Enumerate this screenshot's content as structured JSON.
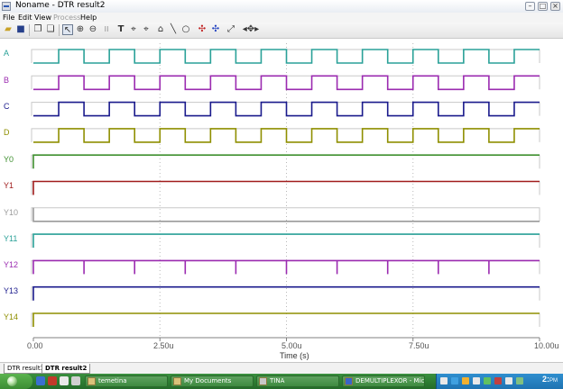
{
  "window": {
    "title": "Noname - DTR result2"
  },
  "menu": [
    {
      "label": "File",
      "enabled": true
    },
    {
      "label": "Edit",
      "enabled": true
    },
    {
      "label": "View",
      "enabled": true
    },
    {
      "label": "Process",
      "enabled": false
    },
    {
      "label": "Help",
      "enabled": true
    }
  ],
  "toolbar": {
    "icons": [
      "open-icon",
      "save-icon",
      "copy-icon",
      "paste-icon",
      "pointer-icon",
      "zoom-in-icon",
      "zoom-out-icon",
      "grid-icon",
      "text-icon",
      "cursor-a-icon",
      "cursor-b-icon",
      "line-icon",
      "wire-icon",
      "circle-icon",
      "marker-red-icon",
      "marker-blue-icon",
      "edit-graph-icon",
      "pan-icon"
    ],
    "pressed": "pointer-icon"
  },
  "chart_data": {
    "type": "line",
    "xlabel": "Time (s)",
    "xlim": [
      0,
      10
    ],
    "x_ticks": [
      "0.00",
      "2.50u",
      "5.00u",
      "7.50u",
      "10.00u"
    ],
    "grid": true,
    "series": [
      {
        "name": "A",
        "color": "#2aa198",
        "kind": "clock",
        "period": 1.0,
        "first_rise": 0.5
      },
      {
        "name": "B",
        "color": "#9b2bb0",
        "kind": "clock",
        "period": 1.0,
        "first_rise": 0.5
      },
      {
        "name": "C",
        "color": "#1a1a8c",
        "kind": "clock",
        "period": 1.0,
        "first_rise": 0.5
      },
      {
        "name": "D",
        "color": "#8f8f00",
        "kind": "clock",
        "period": 1.0,
        "first_rise": 0.5
      },
      {
        "name": "Y0",
        "color": "#3f8f2f",
        "kind": "high"
      },
      {
        "name": "Y1",
        "color": "#a01c1c",
        "kind": "high"
      },
      {
        "name": "Y10",
        "color": "#9a9a9a",
        "kind": "low"
      },
      {
        "name": "Y11",
        "color": "#2aa198",
        "kind": "high"
      },
      {
        "name": "Y12",
        "color": "#9b2bb0",
        "kind": "high_glitch",
        "glitches": [
          1,
          2,
          3,
          4,
          5,
          6,
          7,
          8,
          9
        ]
      },
      {
        "name": "Y13",
        "color": "#1a1a8c",
        "kind": "high"
      },
      {
        "name": "Y14",
        "color": "#8f8f00",
        "kind": "high"
      }
    ]
  },
  "tabs": [
    {
      "label": "DTR result1",
      "active": false
    },
    {
      "label": "DTR result2",
      "active": true
    }
  ],
  "taskbar": {
    "tasks": [
      {
        "label": "temetina",
        "active": false
      },
      {
        "label": "My Documents",
        "active": false
      },
      {
        "label": "TINA",
        "active": false
      },
      {
        "label": "DEMULTIPLEXOR - Mic...",
        "active": false
      }
    ],
    "clock": {
      "time": "2:",
      "suffix": "PM"
    }
  }
}
